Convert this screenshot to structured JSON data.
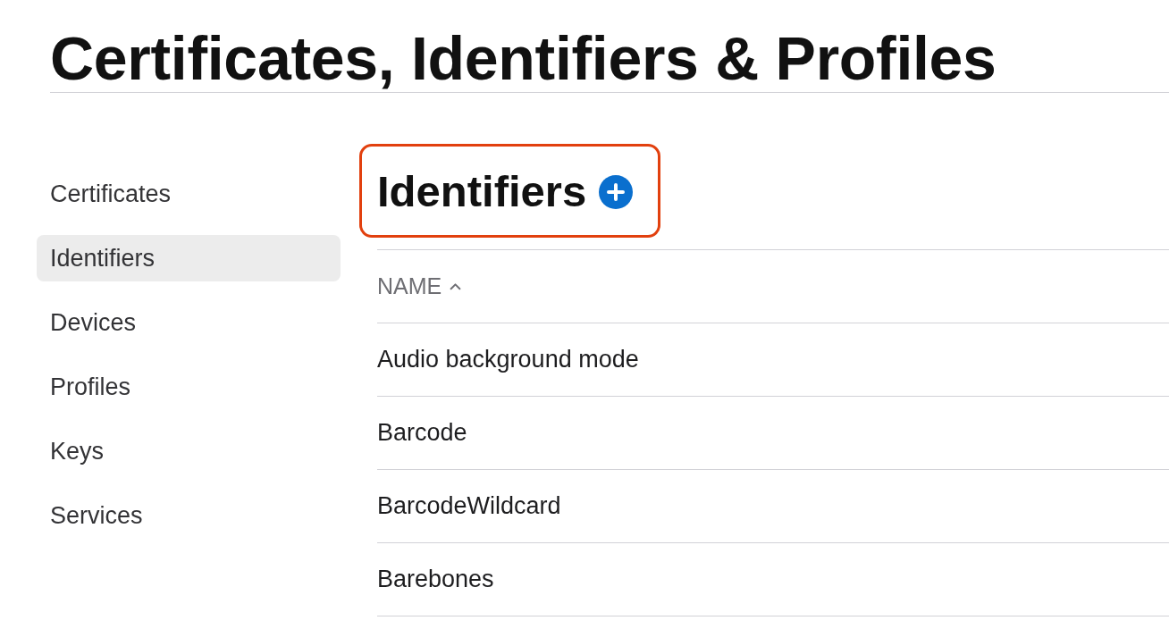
{
  "page": {
    "title": "Certificates, Identifiers & Profiles"
  },
  "sidebar": {
    "items": [
      {
        "label": "Certificates",
        "selected": false
      },
      {
        "label": "Identifiers",
        "selected": true
      },
      {
        "label": "Devices",
        "selected": false
      },
      {
        "label": "Profiles",
        "selected": false
      },
      {
        "label": "Keys",
        "selected": false
      },
      {
        "label": "Services",
        "selected": false
      }
    ]
  },
  "section": {
    "title": "Identifiers",
    "highlighted": true
  },
  "table": {
    "columns": [
      {
        "label": "NAME",
        "sorted_ascending": true
      }
    ],
    "rows": [
      {
        "name": "Audio background mode"
      },
      {
        "name": "Barcode"
      },
      {
        "name": "BarcodeWildcard"
      },
      {
        "name": "Barebones"
      }
    ]
  }
}
